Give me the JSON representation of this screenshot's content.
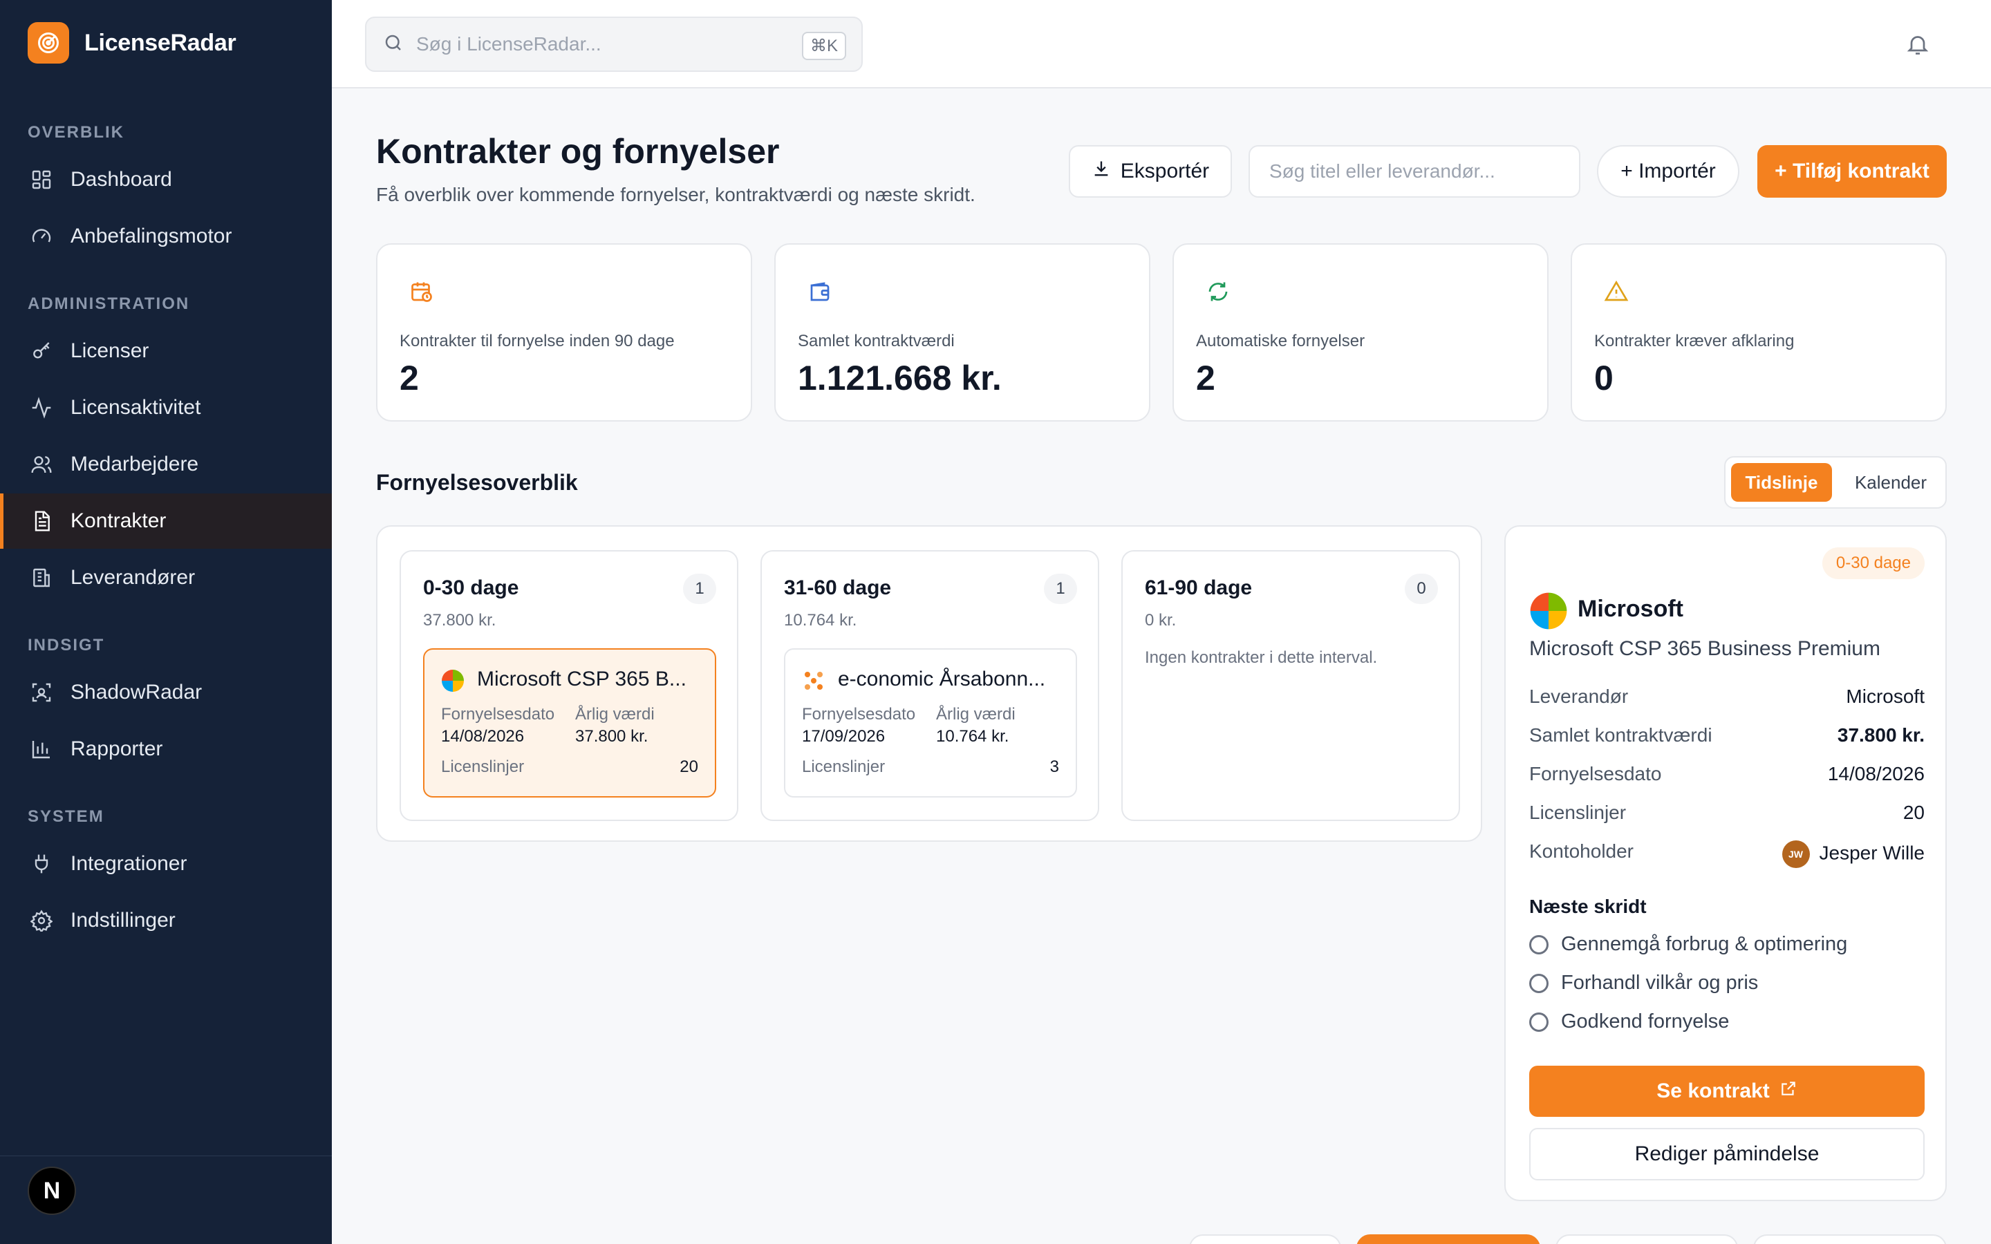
{
  "app": {
    "name": "LicenseRadar"
  },
  "sidebar": {
    "sections": [
      {
        "label": "OVERBLIK"
      },
      {
        "label": "ADMINISTRATION"
      },
      {
        "label": "INDSIGT"
      },
      {
        "label": "SYSTEM"
      }
    ],
    "items": [
      {
        "label": "Dashboard",
        "icon": "dashboard-icon"
      },
      {
        "label": "Anbefalingsmotor",
        "icon": "gauge-icon"
      },
      {
        "label": "Licenser",
        "icon": "key-icon"
      },
      {
        "label": "Licensaktivitet",
        "icon": "activity-icon"
      },
      {
        "label": "Medarbejdere",
        "icon": "users-icon"
      },
      {
        "label": "Kontrakter",
        "icon": "document-icon",
        "active": true
      },
      {
        "label": "Leverandører",
        "icon": "building-icon"
      },
      {
        "label": "ShadowRadar",
        "icon": "scan-icon"
      },
      {
        "label": "Rapporter",
        "icon": "bar-chart-icon"
      },
      {
        "label": "Integrationer",
        "icon": "plug-icon"
      },
      {
        "label": "Indstillinger",
        "icon": "gear-icon"
      }
    ],
    "user_initial": "N"
  },
  "topbar": {
    "search_placeholder": "Søg i LicenseRadar...",
    "shortcut": "⌘K"
  },
  "header": {
    "title": "Kontrakter og fornyelser",
    "subtitle": "Få overblik over kommende fornyelser, kontraktværdi og næste skridt.",
    "export_label": "Eksportér",
    "filter_placeholder": "Søg titel eller leverandør...",
    "import_label": "+ Importér",
    "add_label": "+ Tilføj kontrakt"
  },
  "stats": [
    {
      "label": "Kontrakter til fornyelse inden 90 dage",
      "value": "2",
      "icon": "calendar-clock-icon",
      "color": "#f4811f"
    },
    {
      "label": "Samlet kontraktværdi",
      "value": "1.121.668 kr.",
      "icon": "wallet-icon",
      "color": "#3b6fd4"
    },
    {
      "label": "Automatiske fornyelser",
      "value": "2",
      "icon": "refresh-icon",
      "color": "#1f9a5a"
    },
    {
      "label": "Kontrakter kræver afklaring",
      "value": "0",
      "icon": "warning-icon",
      "color": "#e0a21a"
    }
  ],
  "overview": {
    "title": "Fornyelsesoverblik",
    "view_options": [
      "Tidslinje",
      "Kalender"
    ],
    "active_view": "Tidslinje",
    "columns": [
      {
        "title": "0-30 dage",
        "count": "1",
        "sum": "37.800 kr.",
        "cards": [
          {
            "name": "Microsoft CSP 365 B...",
            "date_label": "Fornyelsesdato",
            "date": "14/08/2026",
            "value_label": "Årlig værdi",
            "value": "37.800 kr.",
            "lines_label": "Licenslinjer",
            "lines": "20"
          }
        ]
      },
      {
        "title": "31-60 dage",
        "count": "1",
        "sum": "10.764 kr.",
        "cards": [
          {
            "name": "e-conomic Årsabonn...",
            "date_label": "Fornyelsesdato",
            "date": "17/09/2026",
            "value_label": "Årlig værdi",
            "value": "10.764 kr.",
            "lines_label": "Licenslinjer",
            "lines": "3"
          }
        ]
      },
      {
        "title": "61-90 dage",
        "count": "0",
        "sum": "0 kr.",
        "empty_text": "Ingen kontrakter i dette interval."
      }
    ]
  },
  "detail": {
    "badge": "0-30 dage",
    "vendor": "Microsoft",
    "product": "Microsoft CSP 365 Business Premium",
    "rows": [
      {
        "key": "Leverandør",
        "value": "Microsoft"
      },
      {
        "key": "Samlet kontraktværdi",
        "value": "37.800 kr."
      },
      {
        "key": "Fornyelsesdato",
        "value": "14/08/2026"
      },
      {
        "key": "Licenslinjer",
        "value": "20"
      },
      {
        "key": "Kontoholder",
        "value": "Jesper Wille",
        "initials": "JW"
      }
    ],
    "next_title": "Næste skridt",
    "steps": [
      "Gennemgå forbrug & optimering",
      "Forhandl vilkår og pris",
      "Godkend fornyelse"
    ],
    "view_label": "Se kontrakt",
    "edit_label": "Rediger påmindelse"
  },
  "colors": {
    "accent": "#f4811f",
    "sidebar": "#152238"
  }
}
